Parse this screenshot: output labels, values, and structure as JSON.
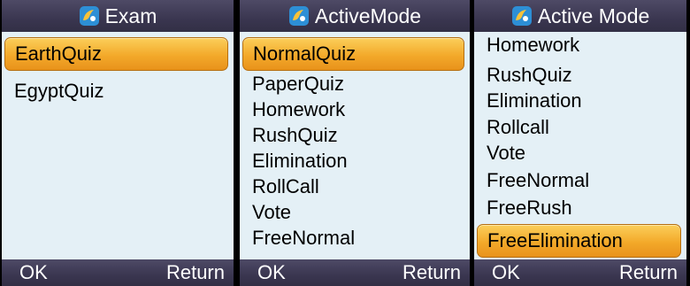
{
  "screens": [
    {
      "title": "Exam",
      "items": [
        "EarthQuiz",
        "EgyptQuiz"
      ],
      "selected_index": 0,
      "ok_label": "OK",
      "return_label": "Return"
    },
    {
      "title": "ActiveMode",
      "items": [
        "NormalQuiz",
        "PaperQuiz",
        "Homework",
        "RushQuiz",
        "Elimination",
        "RollCall",
        "Vote",
        "FreeNormal"
      ],
      "selected_index": 0,
      "ok_label": "OK",
      "return_label": "Return"
    },
    {
      "title": "Active Mode",
      "items": [
        "Homework",
        "RushQuiz",
        "Elimination",
        "Rollcall",
        "Vote",
        "FreeNormal",
        "FreeRush",
        "FreeElimination"
      ],
      "selected_index": 7,
      "ok_label": "OK",
      "return_label": "Return"
    }
  ],
  "icons": {
    "title_icon": "app-logo-icon"
  },
  "colors": {
    "bar": "#3a3650",
    "screen_bg": "#e4f0f6",
    "highlight": "#f3a92a"
  }
}
